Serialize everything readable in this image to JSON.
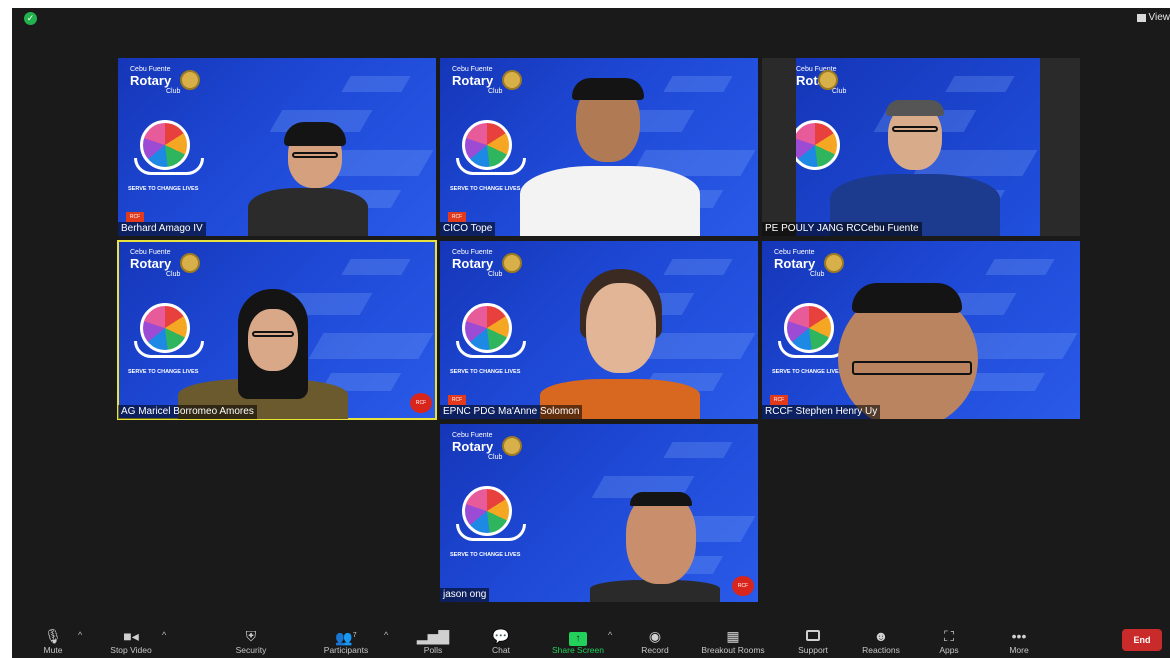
{
  "header": {
    "view_label": "View"
  },
  "participants": [
    {
      "name": "Berhard Amago IV"
    },
    {
      "name": "CICO Tope"
    },
    {
      "name": "PE POULY JANG RCCebu Fuente"
    },
    {
      "name": "AG Maricel Borromeo Amores"
    },
    {
      "name": "EPNC PDG Ma'Anne Solomon"
    },
    {
      "name": "RCCF Stephen Henry Uy"
    },
    {
      "name": "jason ong"
    }
  ],
  "background": {
    "club_line1": "Cebu Fuente",
    "club_line2": "Rotary",
    "club_line3": "Club",
    "tagline": "SERVE TO CHANGE LIVES",
    "brand_color": "#1e49d6"
  },
  "toolbar": {
    "mute": "Mute",
    "stop_video": "Stop Video",
    "security": "Security",
    "participants": "Participants",
    "participants_count": "7",
    "polls": "Polls",
    "chat": "Chat",
    "share_screen": "Share Screen",
    "record": "Record",
    "breakout_rooms": "Breakout Rooms",
    "support": "Support",
    "reactions": "Reactions",
    "apps": "Apps",
    "more": "More",
    "end": "End"
  },
  "colors": {
    "active_speaker_border": "#e8e23a",
    "share_green": "#23d05c",
    "end_red": "#c92b2b"
  }
}
